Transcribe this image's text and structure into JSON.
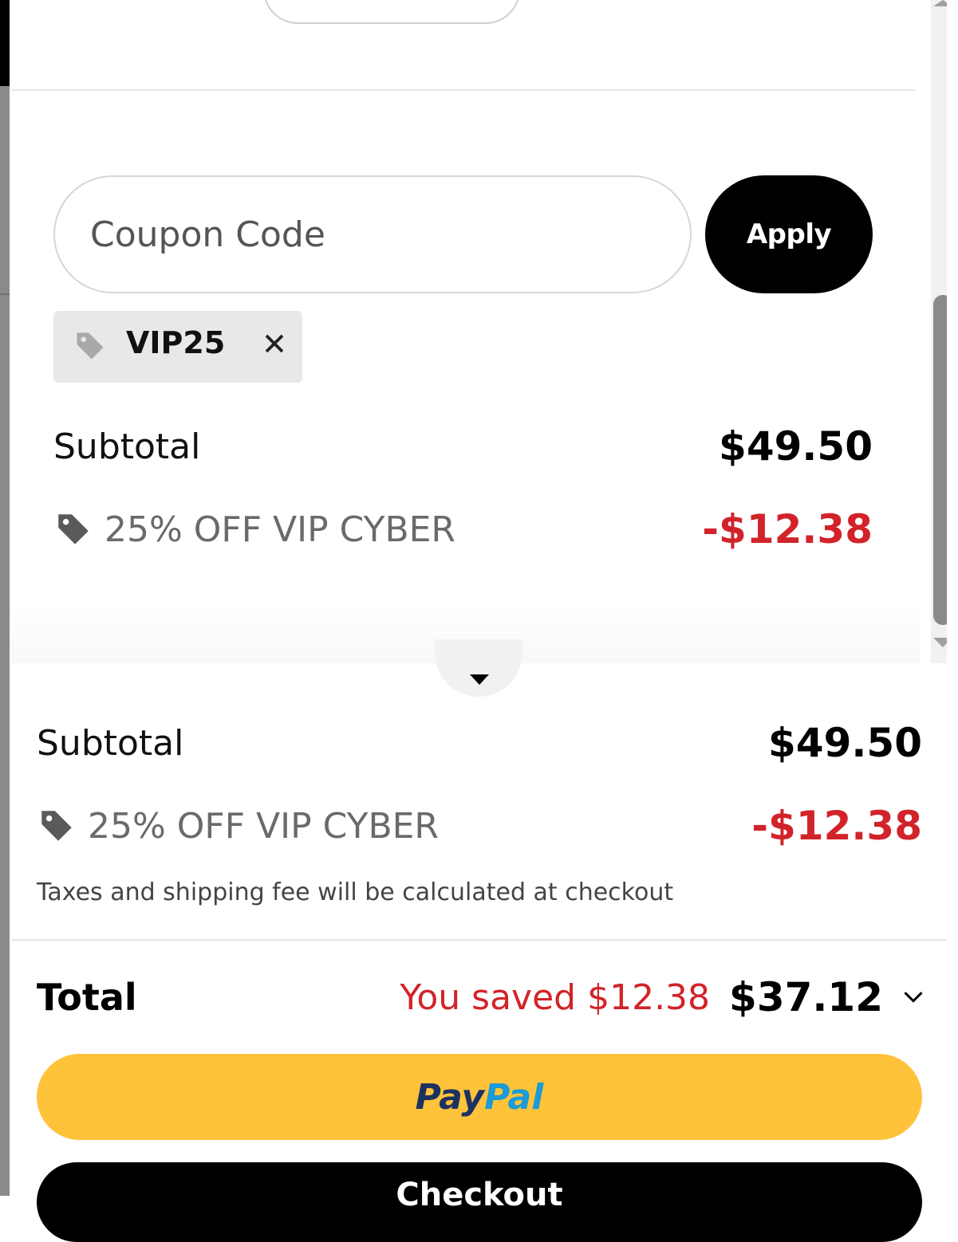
{
  "coupon": {
    "placeholder": "Coupon Code",
    "apply_label": "Apply",
    "applied_code": "VIP25"
  },
  "summary_panel": {
    "subtotal_label": "Subtotal",
    "subtotal_value": "$49.50",
    "discount_label": "25% OFF VIP CYBER",
    "discount_value": "-$12.38"
  },
  "summary_footer": {
    "subtotal_label": "Subtotal",
    "subtotal_value": "$49.50",
    "discount_label": "25% OFF VIP CYBER",
    "discount_value": "-$12.38",
    "tax_note": "Taxes and shipping fee will be calculated at checkout",
    "total_label": "Total",
    "saved_text": "You saved $12.38",
    "total_value": "$37.12"
  },
  "buttons": {
    "paypal_part1": "Pay",
    "paypal_part2": "Pal",
    "checkout_label": "Checkout"
  },
  "icons": {
    "tag": "tag-icon",
    "close": "close-icon",
    "caret": "caret-down-icon",
    "chevron": "chevron-down-icon"
  },
  "colors": {
    "accent_red": "#d2232a",
    "paypal_yellow": "#fec33a",
    "paypal_navy": "#1d3161",
    "paypal_blue": "#1b9bd7",
    "button_black": "#000000"
  }
}
